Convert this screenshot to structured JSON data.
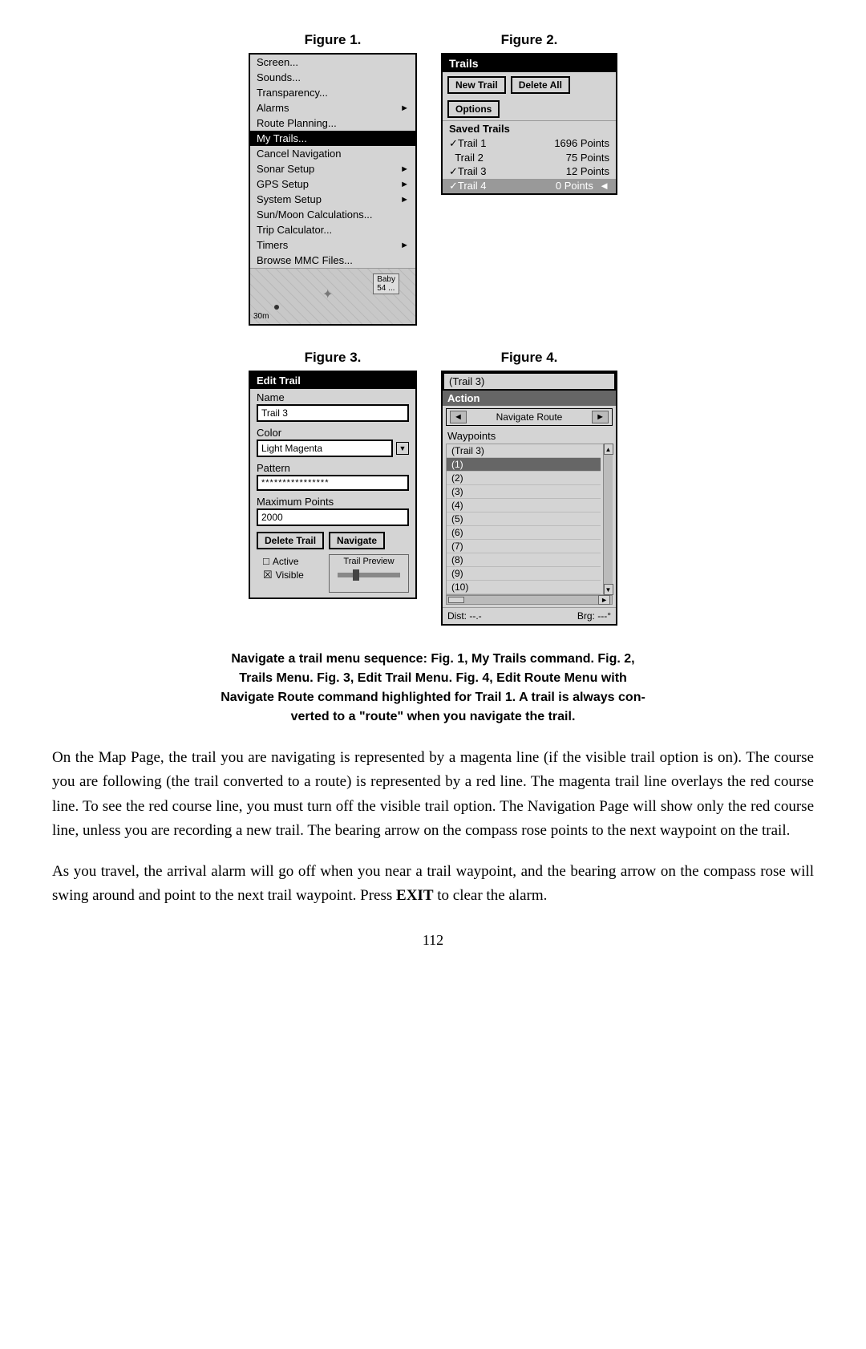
{
  "figures": {
    "fig1": {
      "label": "Figure 1.",
      "menu_items": [
        {
          "text": "Screen...",
          "arrow": false,
          "highlighted": false
        },
        {
          "text": "Sounds...",
          "arrow": false,
          "highlighted": false
        },
        {
          "text": "Transparency...",
          "arrow": false,
          "highlighted": false
        },
        {
          "text": "Alarms",
          "arrow": true,
          "highlighted": false
        },
        {
          "text": "Route Planning...",
          "arrow": false,
          "highlighted": false
        },
        {
          "text": "My Trails...",
          "arrow": false,
          "highlighted": true
        },
        {
          "text": "Cancel Navigation",
          "arrow": false,
          "highlighted": false
        },
        {
          "text": "Sonar Setup",
          "arrow": true,
          "highlighted": false
        },
        {
          "text": "GPS Setup",
          "arrow": true,
          "highlighted": false
        },
        {
          "text": "System Setup",
          "arrow": true,
          "highlighted": false
        },
        {
          "text": "Sun/Moon Calculations...",
          "arrow": false,
          "highlighted": false
        },
        {
          "text": "Trip Calculator...",
          "arrow": false,
          "highlighted": false
        },
        {
          "text": "Timers",
          "arrow": true,
          "highlighted": false
        },
        {
          "text": "Browse MMC Files...",
          "arrow": false,
          "highlighted": false
        }
      ]
    },
    "fig2": {
      "label": "Figure 2.",
      "title": "Trails",
      "new_trail_btn": "New Trail",
      "delete_all_btn": "Delete All",
      "options_btn": "Options",
      "saved_trails_header": "Saved Trails",
      "trails": [
        {
          "check": "✓",
          "name": "Trail 1",
          "points": "1696 Points",
          "highlighted": false
        },
        {
          "check": "",
          "name": "Trail 2",
          "points": "75 Points",
          "highlighted": false
        },
        {
          "check": "✓",
          "name": "Trail 3",
          "points": "12 Points",
          "highlighted": false
        },
        {
          "check": "✓",
          "name": "Trail 4",
          "points": "0 Points",
          "highlighted": true,
          "arrow": "◄"
        }
      ]
    },
    "fig3": {
      "label": "Figure 3.",
      "title": "Edit Trail",
      "name_label": "Name",
      "name_value": "Trail 3",
      "color_label": "Color",
      "color_value": "Light Magenta",
      "pattern_label": "Pattern",
      "pattern_value": "****************",
      "max_points_label": "Maximum Points",
      "max_points_value": "2000",
      "delete_btn": "Delete Trail",
      "navigate_btn": "Navigate",
      "trail_preview_label": "Trail Preview",
      "active_label": "Active",
      "visible_label": "Visible"
    },
    "fig4": {
      "label": "Figure 4.",
      "title": "(Trail 3)",
      "action_label": "Action",
      "navigate_route_label": "Navigate Route",
      "waypoints_label": "Waypoints",
      "trail_item": "(Trail 3)",
      "waypoints": [
        "(1)",
        "(2)",
        "(3)",
        "(4)",
        "(5)",
        "(6)",
        "(7)",
        "(8)",
        "(9)",
        "(10)"
      ],
      "dist_label": "Dist: --.-",
      "brg_label": "Brg: ---°"
    }
  },
  "caption": {
    "line1": "Navigate a trail menu sequence: Fig. 1, My Trails command. Fig. 2,",
    "line2": "Trails Menu. Fig. 3, Edit Trail Menu. Fig. 4, Edit Route Menu with",
    "line3": "Navigate Route command highlighted for Trail 1. A trail is always con-",
    "line4": "verted to a \"route\" when you navigate the trail."
  },
  "body_paragraphs": [
    "On the Map Page, the trail you are navigating is represented by a magenta line (if the visible trail option is on). The course you are following (the trail converted to a route) is represented by a red line. The magenta trail line overlays the red course line. To see the red course line, you must turn off the visible trail option. The Navigation Page will show only the red course line, unless you are recording a new trail. The bearing arrow on the compass rose points to the next waypoint on the trail.",
    "As you travel, the arrival alarm will go off when you near a trail waypoint, and the bearing arrow on the compass rose will swing around and point to the next trail waypoint. Press EXIT to clear the alarm."
  ],
  "page_number": "112"
}
